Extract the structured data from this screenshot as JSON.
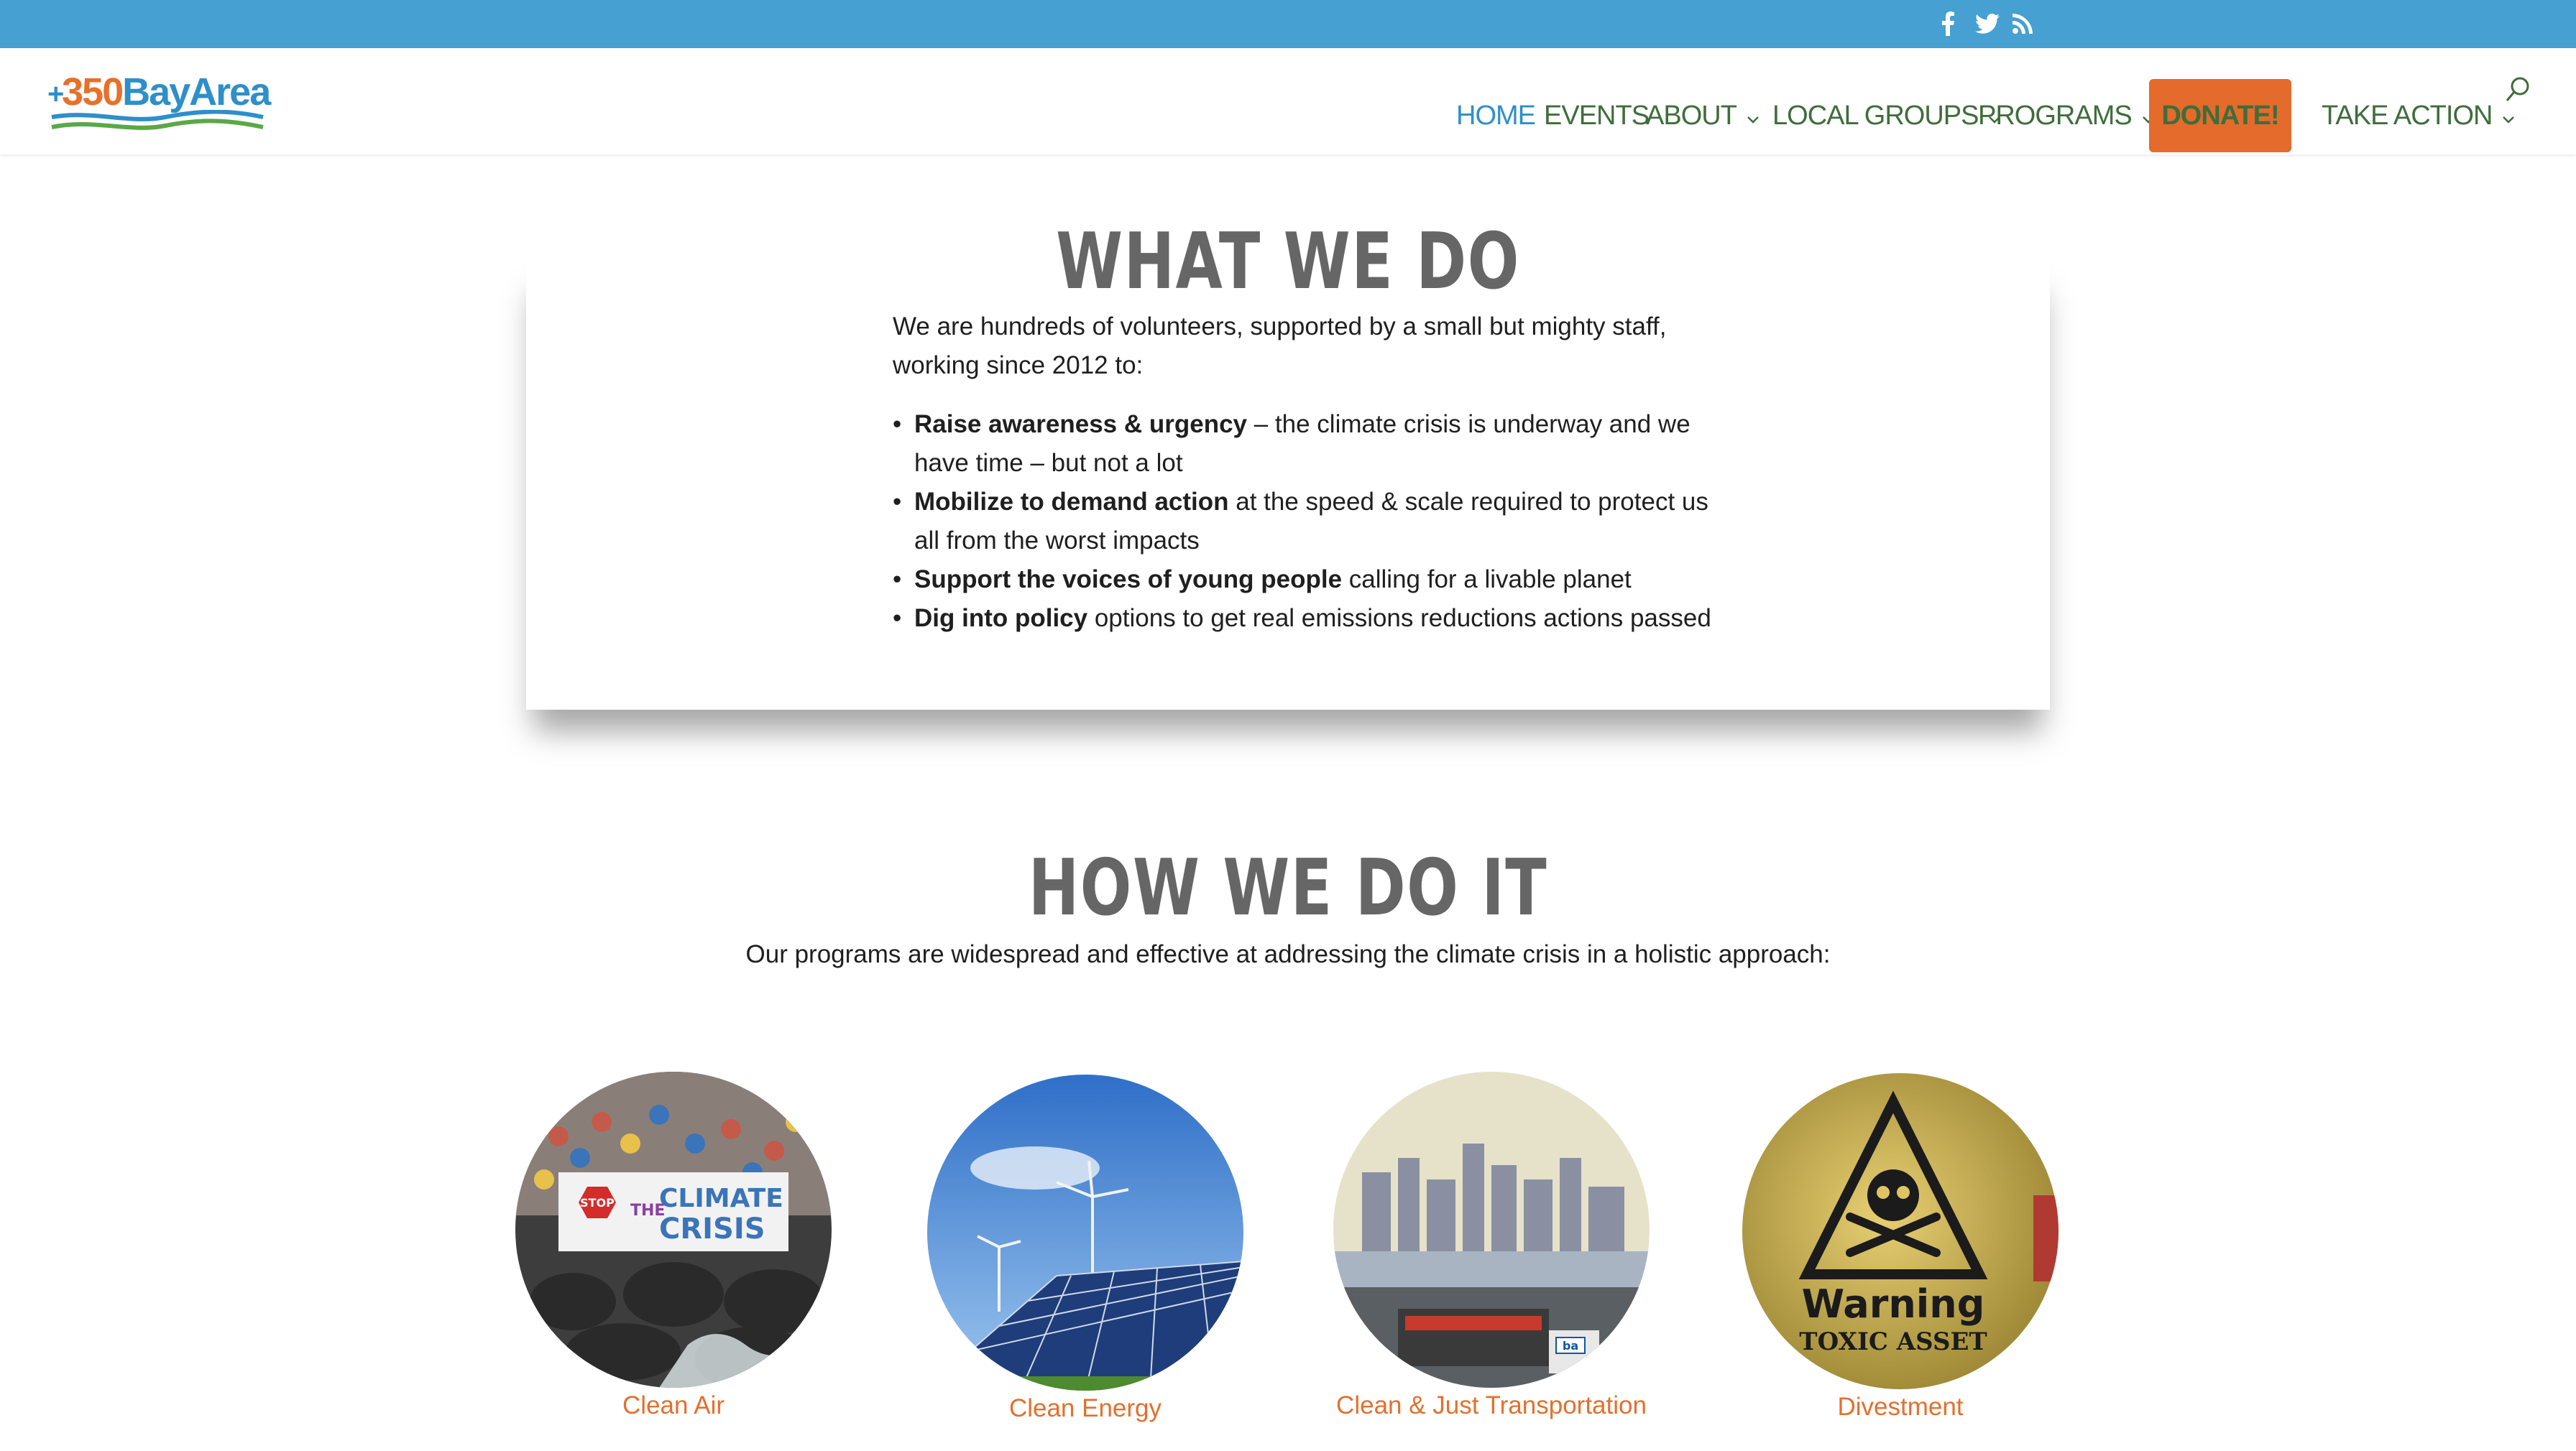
{
  "social": {
    "facebook_icon": "facebook-icon",
    "twitter_icon": "twitter-icon",
    "rss_icon": "rss-icon"
  },
  "logo": {
    "prefix": "+",
    "number": "350",
    "name": "BayArea"
  },
  "nav": {
    "items": [
      {
        "label": "HOME",
        "active": true
      },
      {
        "label": "EVENTS"
      },
      {
        "label": "ABOUT",
        "dropdown": true
      },
      {
        "label": "LOCAL GROUPS",
        "dropdown": true
      },
      {
        "label": "PROGRAMS",
        "dropdown": true
      },
      {
        "label": "DONATE!"
      },
      {
        "label": "TAKE ACTION",
        "dropdown": true
      }
    ]
  },
  "what_we_do": {
    "title": "WHAT WE DO",
    "intro": "We are hundreds of volunteers, supported by a small but mighty staff, working since 2012 to:",
    "bullets": [
      {
        "bold": "Raise awareness & urgency",
        "rest": " – the climate crisis is underway and we have time – but not a lot"
      },
      {
        "bold": "Mobilize to demand action",
        "rest": " at the speed & scale required to protect us all from the worst impacts"
      },
      {
        "bold": "Support the voices of young people",
        "rest": " calling for a livable planet"
      },
      {
        "bold": "Dig into policy",
        "rest": " options to get real emissions reductions actions passed"
      }
    ]
  },
  "how_we_do_it": {
    "title": "HOW WE DO IT",
    "subtitle": "Our programs are widespread and effective at addressing the climate crisis in a holistic approach:"
  },
  "programs": [
    {
      "label": "Clean Air",
      "banner_text_1": "STOP",
      "banner_text_2": "THE",
      "banner_text_3": "CLIMATE",
      "banner_text_4": "CRISIS"
    },
    {
      "label": "Clean Energy"
    },
    {
      "label": "Clean & Just Transportation",
      "badge": "ba"
    },
    {
      "label": "Divestment",
      "sign_line_1": "Warning",
      "sign_line_2": "TOXIC ASSET"
    }
  ],
  "colors": {
    "topbar": "#46a0d1",
    "nav_text": "#3f6d3b",
    "nav_active": "#2e8fc9",
    "donate_bg": "#e46b2b",
    "heading": "#666666",
    "program_label": "#e2702e"
  }
}
